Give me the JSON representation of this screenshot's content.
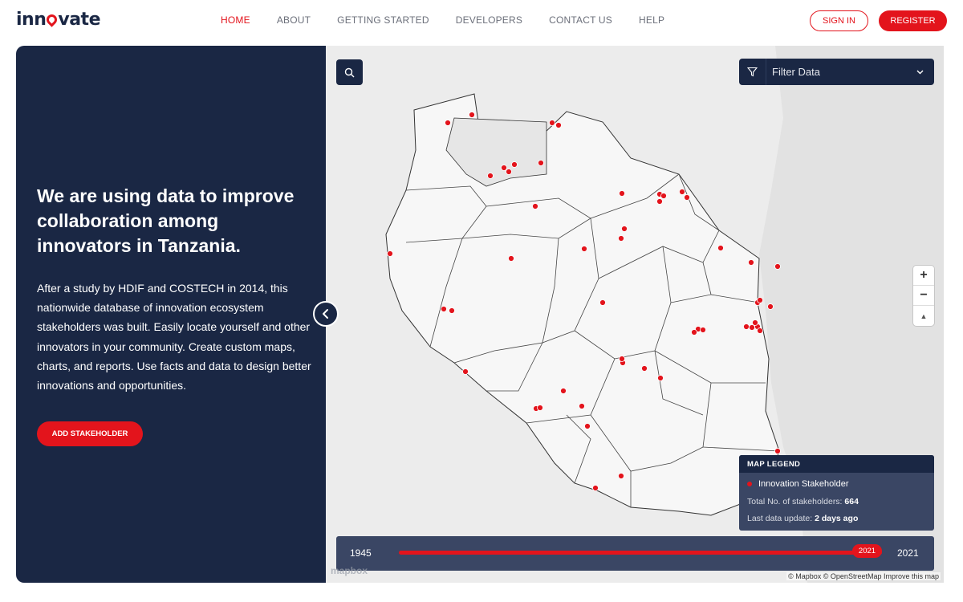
{
  "brand": {
    "logo_left": "inn",
    "logo_right": "vate",
    "accent": "#e3141c",
    "navy": "#1a2744"
  },
  "nav": {
    "items": [
      {
        "label": "HOME",
        "active": true
      },
      {
        "label": "ABOUT"
      },
      {
        "label": "GETTING STARTED"
      },
      {
        "label": "DEVELOPERS"
      },
      {
        "label": "CONTACT US"
      },
      {
        "label": "HELP"
      }
    ],
    "sign_in": "SIGN IN",
    "register": "REGISTER"
  },
  "hero": {
    "title": "We are using data to improve collaboration among innovators in Tanzania.",
    "body": "After a study by HDIF and COSTECH in 2014, this nationwide database of innovation ecosystem stakeholders was built. Easily locate yourself and other innovators in your community. Create custom maps, charts, and reports. Use facts and data to design better innovations and opportunities.",
    "cta": "ADD STAKEHOLDER"
  },
  "map": {
    "search_icon": "search-icon",
    "filter_label": "Filter Data",
    "legend": {
      "title": "MAP LEGEND",
      "item": "Innovation Stakeholder",
      "total_label": "Total No. of stakeholders:",
      "total_value": "664",
      "update_label": "Last data update:",
      "update_value": "2 days ago"
    },
    "timeline": {
      "start": "1945",
      "end": "2021",
      "selected": "2021"
    },
    "zoom_in": "+",
    "zoom_out": "−",
    "compass": "▲",
    "mapbox_logo": "mapbox",
    "attribution": "© Mapbox © OpenStreetMap Improve this map"
  }
}
